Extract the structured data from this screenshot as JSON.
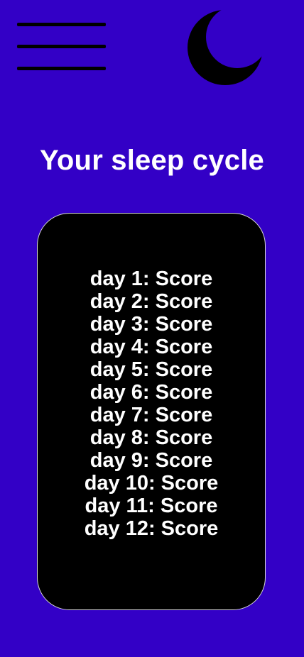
{
  "header": {
    "menu_icon": "hamburger-menu-icon",
    "theme_icon": "crescent-moon-icon"
  },
  "colors": {
    "background": "#3300c6",
    "card": "#000000",
    "text": "#ffffff",
    "icon": "#000000"
  },
  "main": {
    "title": "Your sleep cycle",
    "scores": [
      "day 1: Score",
      "day 2: Score",
      "day 3: Score",
      "day 4: Score",
      "day 5: Score",
      "day 6: Score",
      "day 7: Score",
      "day 8: Score",
      "day 9: Score",
      "day 10: Score",
      "day 11: Score",
      "day 12: Score"
    ]
  }
}
